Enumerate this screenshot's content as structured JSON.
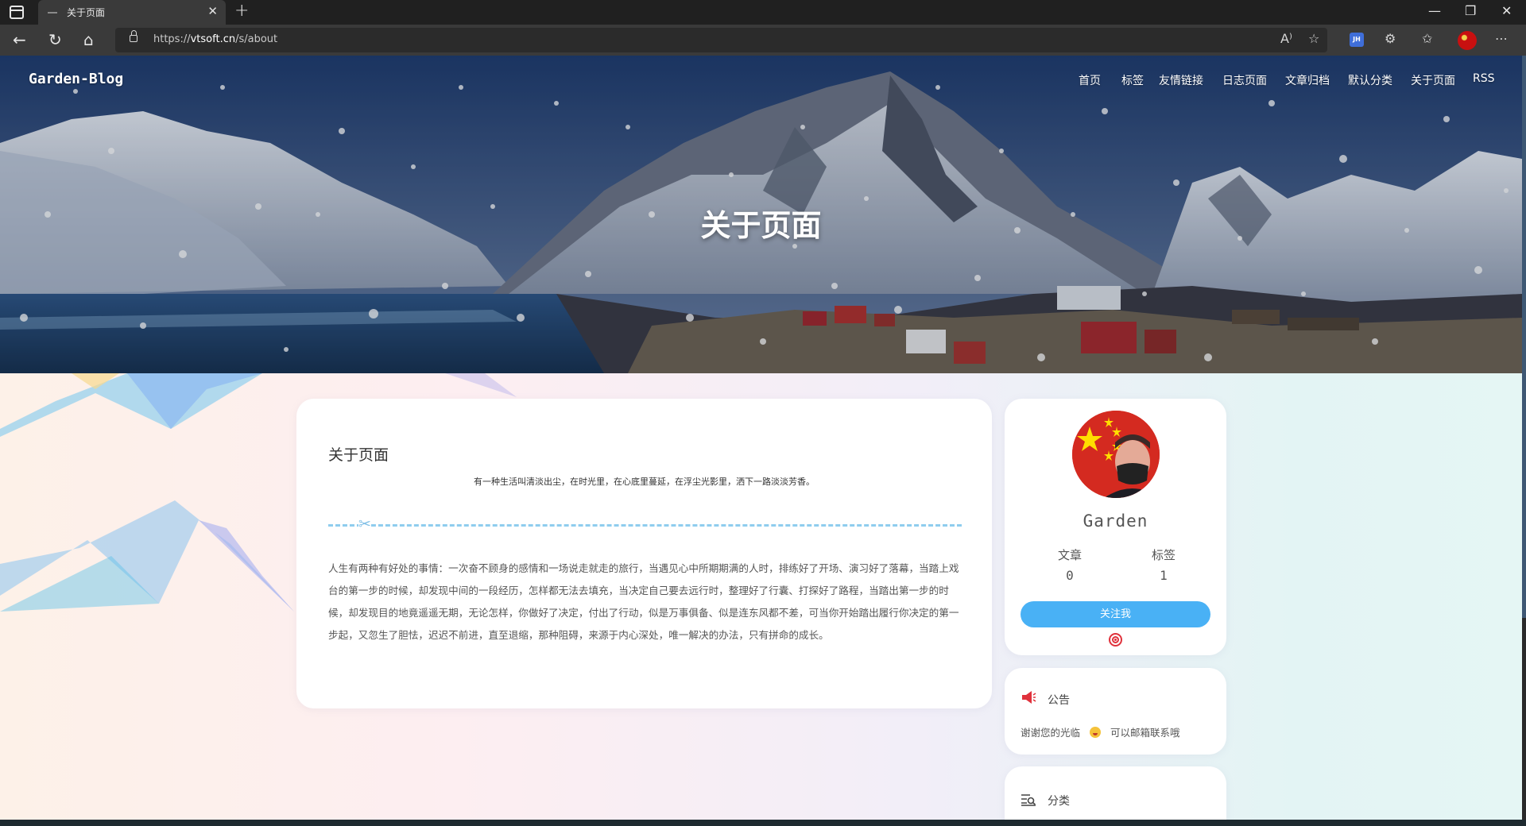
{
  "browser": {
    "tab_title": "关于页面",
    "tab_close": "✕",
    "new_tab": "+",
    "url_scheme": "https://",
    "url_host": "vtsoft.cn",
    "url_path": "/s/about",
    "read_aloud_icon": "A⁾",
    "ext_badge": "JH",
    "window_controls": [
      "—",
      "❐",
      "✕"
    ]
  },
  "site": {
    "brand": "Garden-Blog",
    "nav": [
      "首页",
      "标签",
      "友情链接",
      "日志页面",
      "文章归档",
      "默认分类",
      "关于页面",
      "RSS"
    ],
    "hero_title": "关于页面"
  },
  "article": {
    "title": "关于页面",
    "motto": "有一种生活叫清淡出尘，在时光里，在心底里蔓延，在浮尘光影里，洒下一路淡淡芳香。",
    "body": "人生有两种有好处的事情：一次奋不顾身的感情和一场说走就走的旅行，当遇见心中所期期满的人时，排练好了开场、演习好了落幕，当踏上戏台的第一步的时候，却发现中间的一段经历，怎样都无法去填充，当决定自己要去远行时，整理好了行囊、打探好了路程，当踏出第一步的时候，却发现目的地竟遥遥无期，无论怎样，你做好了决定，付出了行动，似是万事俱备、似是连东风都不差，可当你开始踏出履行你决定的第一步起，又忽生了胆怯，迟迟不前进，直至退缩，那种阻碍，来源于内心深处，唯一解决的办法，只有拼命的成长。"
  },
  "sidebar": {
    "author": "Garden",
    "stats": [
      {
        "label": "文章",
        "value": "0"
      },
      {
        "label": "标签",
        "value": "1"
      }
    ],
    "follow_label": "关注我",
    "notice_title": "公告",
    "notice_text_1": "谢谢您的光临",
    "notice_text_2": "可以邮箱联系哦",
    "category_title": "分类"
  },
  "colors": {
    "accent": "#49b1f5",
    "divider": "#8fcdee",
    "notice_icon": "#e0323c"
  }
}
